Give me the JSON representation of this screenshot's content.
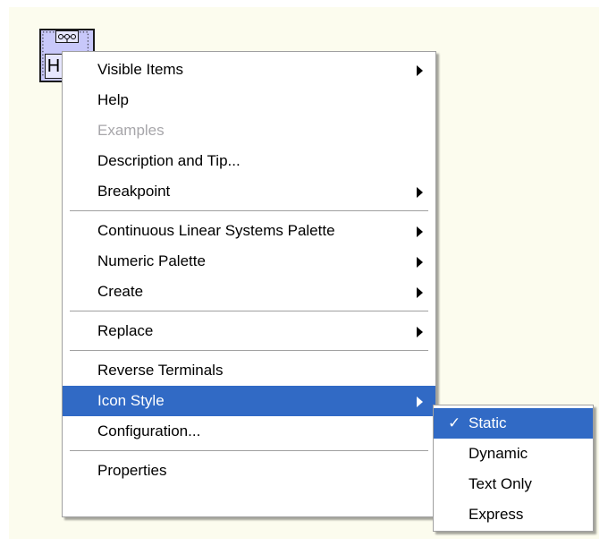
{
  "node": {
    "label": "H"
  },
  "context_menu": {
    "items": [
      {
        "label": "Visible Items",
        "submenu": true,
        "enabled": true
      },
      {
        "label": "Help",
        "submenu": false,
        "enabled": true
      },
      {
        "label": "Examples",
        "submenu": false,
        "enabled": false
      },
      {
        "label": "Description and Tip...",
        "submenu": false,
        "enabled": true
      },
      {
        "label": "Breakpoint",
        "submenu": true,
        "enabled": true
      },
      {
        "label": "Continuous Linear Systems Palette",
        "submenu": true,
        "enabled": true
      },
      {
        "label": "Numeric Palette",
        "submenu": true,
        "enabled": true
      },
      {
        "label": "Create",
        "submenu": true,
        "enabled": true
      },
      {
        "label": "Replace",
        "submenu": true,
        "enabled": true
      },
      {
        "label": "Reverse Terminals",
        "submenu": false,
        "enabled": true
      },
      {
        "label": "Icon Style",
        "submenu": true,
        "enabled": true,
        "highlighted": true
      },
      {
        "label": "Configuration...",
        "submenu": false,
        "enabled": true
      },
      {
        "label": "Properties",
        "submenu": false,
        "enabled": true
      }
    ]
  },
  "icon_style_submenu": {
    "check_mark": "✓",
    "items": [
      {
        "label": "Static",
        "checked": true,
        "highlighted": true
      },
      {
        "label": "Dynamic",
        "checked": false
      },
      {
        "label": "Text Only",
        "checked": false
      },
      {
        "label": "Express",
        "checked": false
      }
    ]
  },
  "colors": {
    "canvas": "#fcfcee",
    "menu_highlight": "#316ac5",
    "node_fill": "#c8c8fa",
    "disabled_text": "#a7a6aa"
  }
}
